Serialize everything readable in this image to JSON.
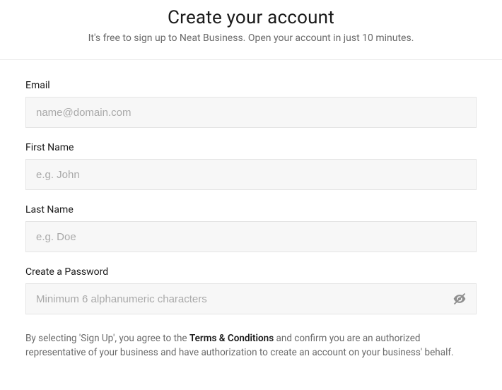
{
  "header": {
    "title": "Create your account",
    "subtitle": "It's free to sign up to Neat Business. Open your account in just 10 minutes."
  },
  "form": {
    "email": {
      "label": "Email",
      "placeholder": "name@domain.com",
      "value": ""
    },
    "first_name": {
      "label": "First Name",
      "placeholder": "e.g. John",
      "value": ""
    },
    "last_name": {
      "label": "Last Name",
      "placeholder": "e.g. Doe",
      "value": ""
    },
    "password": {
      "label": "Create a Password",
      "placeholder": "Minimum 6 alphanumeric characters",
      "value": ""
    }
  },
  "terms": {
    "prefix": "By selecting 'Sign Up', you agree to the ",
    "link": "Terms & Conditions",
    "suffix": " and confirm you are an authorized representative of your business and have authorization to create an account on your business' behalf."
  }
}
